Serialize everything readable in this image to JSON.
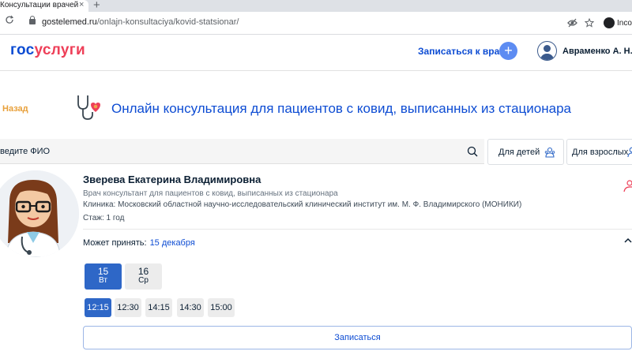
{
  "browser": {
    "tab_title": "Консультации врачей он",
    "tab_close": "×",
    "new_tab": "+",
    "url_domain": "gostelemed.ru",
    "url_path": "/onlajn-konsultaciya/kovid-statsionar/",
    "profile_label": "Inco",
    "nav": {
      "back": "←",
      "forward": "→",
      "reload": "↻"
    },
    "icons": {
      "eye_off": "eye-off-icon",
      "star": "star-icon"
    }
  },
  "header": {
    "logo_part1": "гос",
    "logo_part2": "услуги",
    "book_label": "Записаться к врачу",
    "plus_label": "+",
    "user_name": "Авраменко А. Н.",
    "brand_blue": "#0d4cd3",
    "brand_red": "#ee3f58"
  },
  "page": {
    "back_label": "Назад",
    "title": "Онлайн консультация для пациентов с ковид, выписанных из стационара"
  },
  "search": {
    "placeholder": "ведите ФИО"
  },
  "filters": {
    "children": "Для детей",
    "adults": "Для взрослых"
  },
  "doctor": {
    "name": "Зверева Екатерина Владимировна",
    "position": "Врач консультант для пациентов с ковид, выписанных из стационара",
    "clinic": "Клиника: Московский областной научно-исследовательский клинический институт им. М. Ф. Владимирского (МОНИКИ)",
    "experience": "Стаж: 1 год",
    "can_accept_label": "Может принять:",
    "can_accept_date": "15 декабря"
  },
  "days": [
    {
      "num": "15",
      "weekday": "Вт",
      "active": true
    },
    {
      "num": "16",
      "weekday": "Ср",
      "active": false
    }
  ],
  "times": [
    {
      "label": "12:15",
      "active": true
    },
    {
      "label": "12:30",
      "active": false
    },
    {
      "label": "14:15",
      "active": false
    },
    {
      "label": "14:30",
      "active": false
    },
    {
      "label": "15:00",
      "active": false
    }
  ],
  "book_button": "Записаться"
}
